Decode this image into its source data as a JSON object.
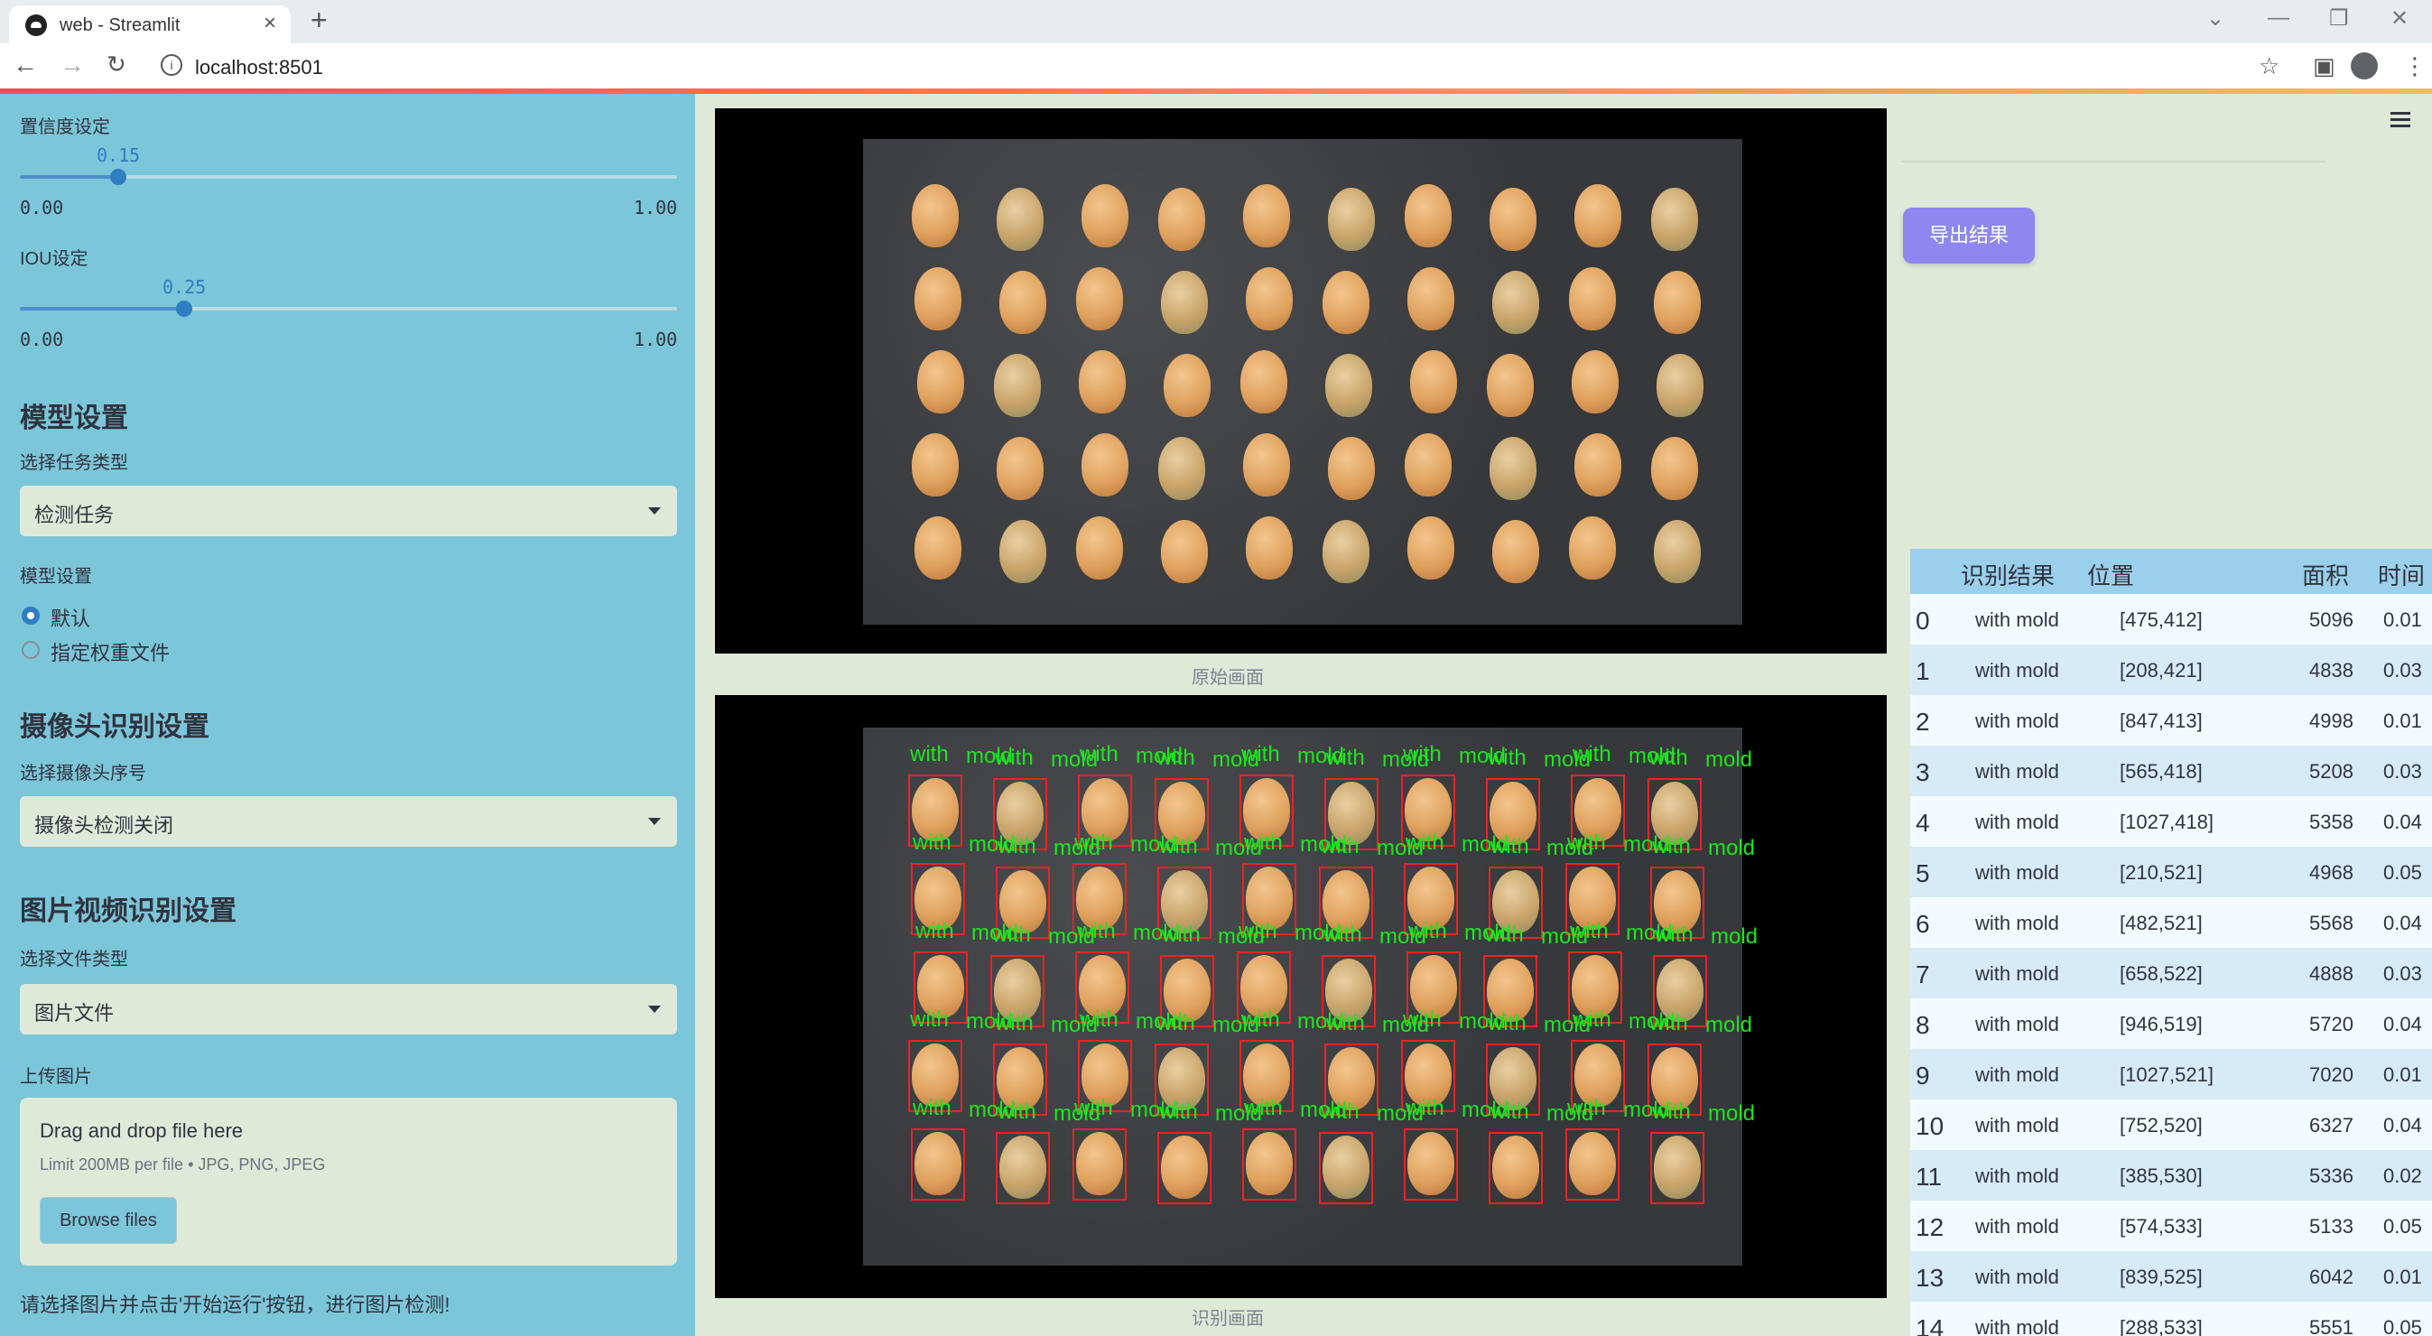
{
  "browser": {
    "tab_title": "web - Streamlit",
    "url": "localhost:8501",
    "tab_close": "×",
    "new_tab": "+"
  },
  "sidebar": {
    "confidence_label": "置信度设定",
    "confidence_value": "0.15",
    "confidence_fraction": 0.15,
    "iou_label": "IOU设定",
    "iou_value": "0.25",
    "iou_fraction": 0.25,
    "slider_min": "0.00",
    "slider_max": "1.00",
    "model_header": "模型设置",
    "task_type_label": "选择任务类型",
    "task_type_value": "检测任务",
    "model_setting_label": "模型设置",
    "radio_default": "默认",
    "radio_custom": "指定权重文件",
    "camera_header": "摄像头识别设置",
    "camera_select_label": "选择摄像头序号",
    "camera_select_value": "摄像头检测关闭",
    "media_header": "图片视频识别设置",
    "file_type_label": "选择文件类型",
    "file_type_value": "图片文件",
    "upload_label": "上传图片",
    "drop_title": "Drag and drop file here",
    "drop_limit": "Limit 200MB per file • JPG, PNG, JPEG",
    "browse_label": "Browse files",
    "hint": "请选择图片并点击'开始运行'按钮，进行图片检测!"
  },
  "main": {
    "original_caption": "原始画面",
    "detected_caption": "识别画面",
    "detection_label_word1": "with",
    "detection_label_word2": "mold"
  },
  "right": {
    "export_label": "导出结果"
  },
  "table": {
    "headers": [
      "识别结果",
      "位置",
      "面积",
      "时间"
    ],
    "rows": [
      {
        "idx": "0",
        "result": "with mold",
        "pos": "[475,412]",
        "area": "5096",
        "time": "0.01"
      },
      {
        "idx": "1",
        "result": "with mold",
        "pos": "[208,421]",
        "area": "4838",
        "time": "0.03"
      },
      {
        "idx": "2",
        "result": "with mold",
        "pos": "[847,413]",
        "area": "4998",
        "time": "0.01"
      },
      {
        "idx": "3",
        "result": "with mold",
        "pos": "[565,418]",
        "area": "5208",
        "time": "0.03"
      },
      {
        "idx": "4",
        "result": "with mold",
        "pos": "[1027,418]",
        "area": "5358",
        "time": "0.04"
      },
      {
        "idx": "5",
        "result": "with mold",
        "pos": "[210,521]",
        "area": "4968",
        "time": "0.05"
      },
      {
        "idx": "6",
        "result": "with mold",
        "pos": "[482,521]",
        "area": "5568",
        "time": "0.04"
      },
      {
        "idx": "7",
        "result": "with mold",
        "pos": "[658,522]",
        "area": "4888",
        "time": "0.03"
      },
      {
        "idx": "8",
        "result": "with mold",
        "pos": "[946,519]",
        "area": "5720",
        "time": "0.04"
      },
      {
        "idx": "9",
        "result": "with mold",
        "pos": "[1027,521]",
        "area": "7020",
        "time": "0.01"
      },
      {
        "idx": "10",
        "result": "with mold",
        "pos": "[752,520]",
        "area": "6327",
        "time": "0.04"
      },
      {
        "idx": "11",
        "result": "with mold",
        "pos": "[385,530]",
        "area": "5336",
        "time": "0.02"
      },
      {
        "idx": "12",
        "result": "with mold",
        "pos": "[574,533]",
        "area": "5133",
        "time": "0.05"
      },
      {
        "idx": "13",
        "result": "with mold",
        "pos": "[839,525]",
        "area": "6042",
        "time": "0.01"
      },
      {
        "idx": "14",
        "result": "with mold",
        "pos": "[288,533]",
        "area": "5551",
        "time": "0.05"
      }
    ]
  }
}
